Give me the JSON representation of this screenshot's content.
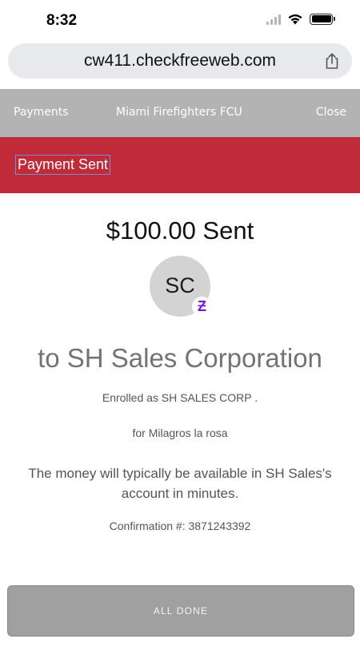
{
  "status_bar": {
    "time": "8:32",
    "icons": [
      "cellular-signal-icon",
      "wifi-icon",
      "battery-icon"
    ]
  },
  "browser": {
    "url": "cw411.checkfreeweb.com",
    "share_icon": "share-icon"
  },
  "site_nav": {
    "payments_label": "Payments",
    "title": "Miami Firefighters FCU",
    "close_label": "Close",
    "background": "#b3b3b3"
  },
  "banner": {
    "title": "Payment Sent",
    "color": "#c12a39"
  },
  "confirmation": {
    "amount_text": "$100.00 Sent",
    "avatar_initials": "SC",
    "badge_icon": "zelle-icon",
    "recipient_text": "to SH Sales Corporation",
    "enrolled_text": "Enrolled as SH SALES CORP .",
    "for_text": "for Milagros la rosa",
    "availability_text": "The money will typically be available in SH Sales's account in minutes.",
    "confirmation_text": "Confirmation #: 3871243392"
  },
  "actions": {
    "done_label": "ALL DONE"
  }
}
